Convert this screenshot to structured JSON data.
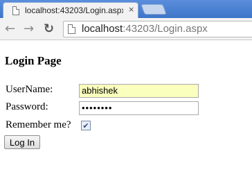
{
  "browser": {
    "tab_title": "localhost:43203/Login.aspx",
    "tab_close": "×",
    "url_host": "localhost",
    "url_rest": ":43203/Login.aspx",
    "icons": {
      "back": "arrow-left",
      "forward": "arrow-right",
      "reload": "reload"
    }
  },
  "page": {
    "heading": "Login Page",
    "username_label": "UserName:",
    "username_value": "abhishek",
    "password_label": "Password:",
    "password_value": "••••••••",
    "remember_label": "Remember me?",
    "remember_checked": true,
    "login_button": "Log In"
  },
  "colors": {
    "chrome_blue": "#4a82d4",
    "autofill_yellow": "#faffbd"
  }
}
